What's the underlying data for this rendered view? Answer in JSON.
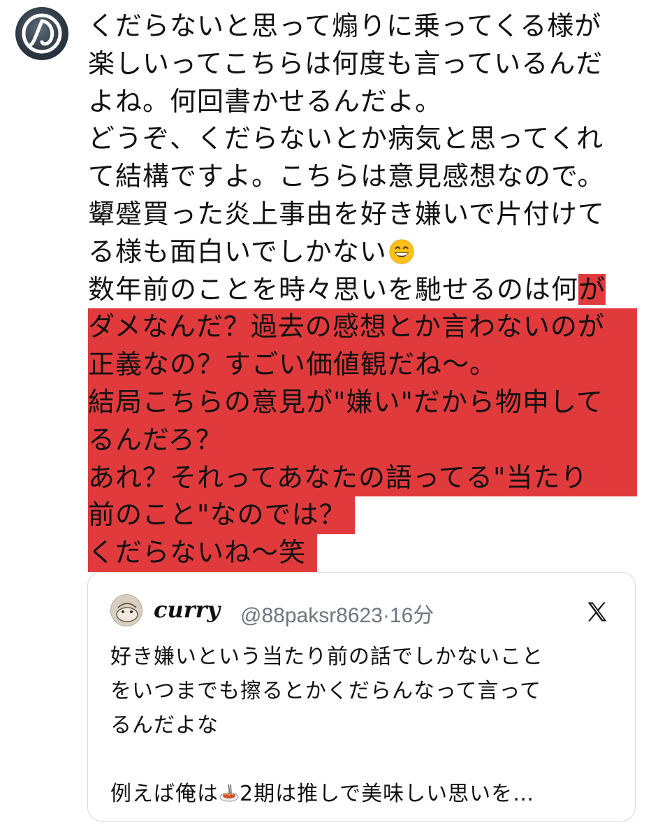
{
  "post": {
    "lines": [
      {
        "pre": "くだらないと思って煽りに乗ってくる様が",
        "hl": ""
      },
      {
        "pre": "楽しいってこちらは何度も言っているんだ",
        "hl": ""
      },
      {
        "pre": "よね。何回書かせるんだよ。",
        "hl": ""
      },
      {
        "pre": "どうぞ、くだらないとか病気と思ってくれ",
        "hl": ""
      },
      {
        "pre": "て結構ですよ。こちらは意見感想なので。",
        "hl": ""
      },
      {
        "pre": "顰蹙買った炎上事由を好き嫌いで片付けて",
        "hl": ""
      },
      {
        "pre": "る様も面白いでしかない",
        "hl": ""
      },
      {
        "pre": "数年前のことを時々思いを馳せるのは何",
        "hl": "が"
      },
      {
        "pre": "",
        "hl": "ダメなんだ？過去の感想とか言わないのが"
      },
      {
        "pre": "",
        "hl": "正義なの？すごい価値観だね〜。"
      },
      {
        "pre": "",
        "hl": "結局こちらの意見が\"嫌い\"だから物申して"
      },
      {
        "pre": "",
        "hl": "るんだろ？"
      },
      {
        "pre": "",
        "hl": "あれ？それってあなたの語ってる\"当たり"
      },
      {
        "pre": "",
        "hl": "前のこと\"なのでは？"
      },
      {
        "pre": "",
        "hl": "くだらないね〜笑"
      }
    ],
    "emoji_icon": "grinning-face-emoji",
    "highlight_color": "#e03a3d"
  },
  "quote": {
    "name": "curry",
    "handle": "@88paksr8623",
    "time": "·16分",
    "lines": [
      "好き嫌いという当たり前の話でしかないこと",
      "をいつまでも擦るとかくだらんなって言って",
      "るんだよな",
      "",
      {
        "pre": "例えば俺は",
        "post": "2期は推しで美味しい思いを…"
      }
    ],
    "platform_icon": "x-logo-icon",
    "inline_icon": "spaghetti-emoji"
  }
}
